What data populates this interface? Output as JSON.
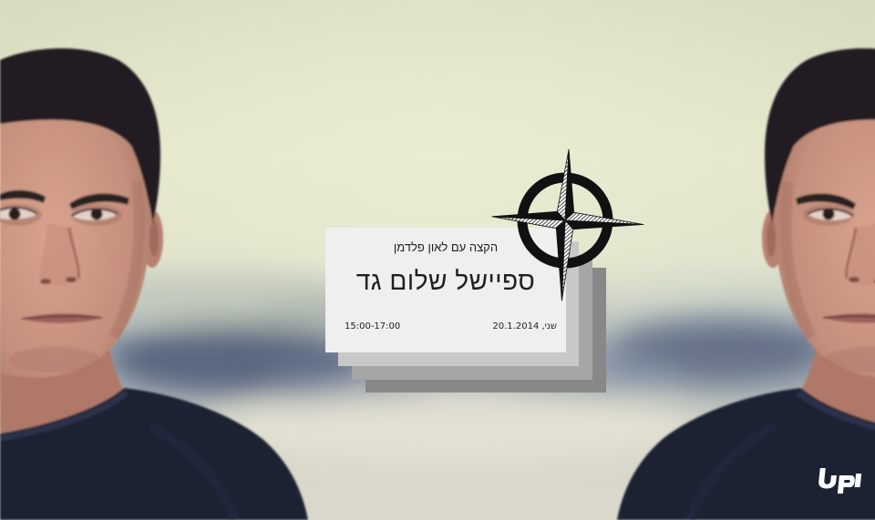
{
  "banner": {
    "event": {
      "subtitle": "הקצה עם לאון פלדמן",
      "title": "ספיישל שלום גד",
      "date": "שני, 20.1.2014",
      "time": "15:00-17:00"
    }
  },
  "icons": {
    "compass": "compass-rose-icon",
    "logo": "brand-logo"
  },
  "colors": {
    "card": "#efefef",
    "card_layer_1": "#c8c8c8",
    "card_layer_2": "#a6a6a6",
    "card_layer_3": "#888888",
    "text": "#1f1f1f",
    "compass": "#111111",
    "logo": "#ffffff"
  }
}
